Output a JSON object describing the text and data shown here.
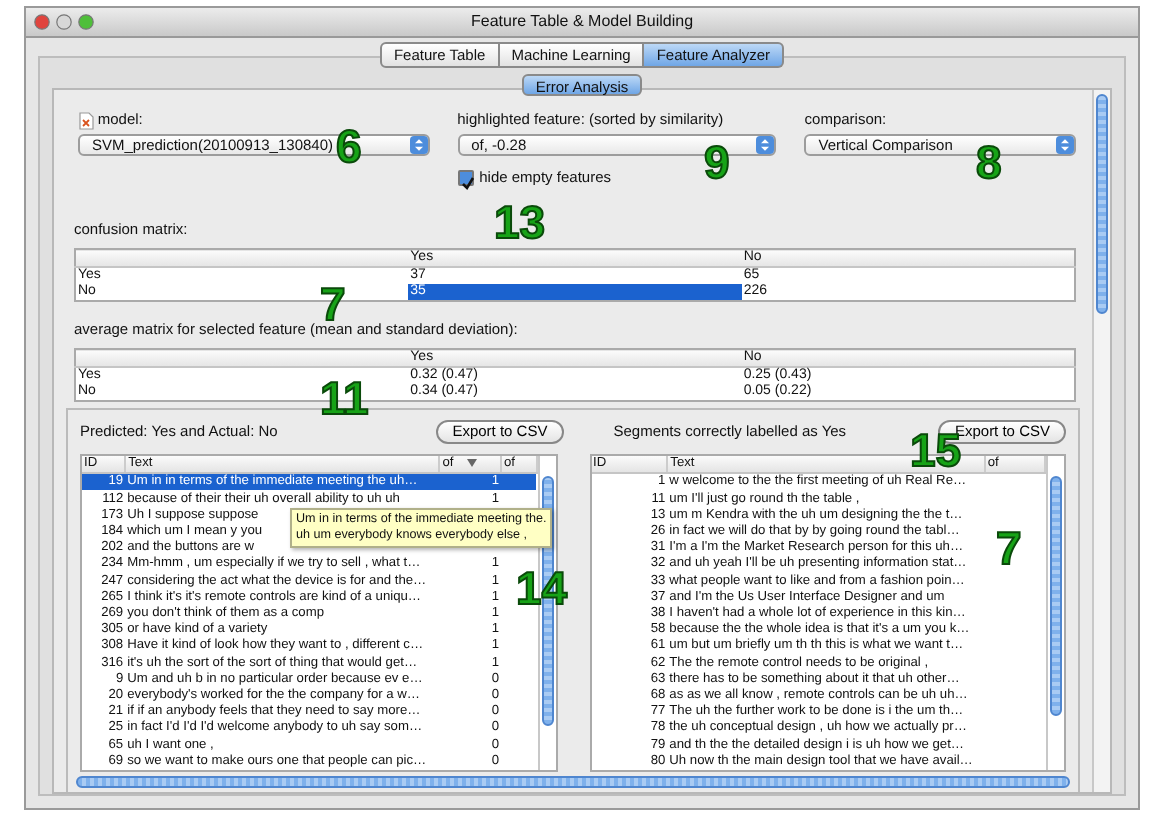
{
  "window": {
    "title": "Feature Table & Model Building"
  },
  "tabs": [
    {
      "label": "Feature Table",
      "selected": false
    },
    {
      "label": "Machine Learning",
      "selected": false
    },
    {
      "label": "Feature Analyzer",
      "selected": true
    }
  ],
  "subtabs": [
    {
      "label": "Error Analysis",
      "selected": true
    }
  ],
  "model": {
    "label": "model:",
    "value": "SVM_prediction(20100913_130840)"
  },
  "highlighted_feature": {
    "label": "highlighted feature: (sorted by similarity)",
    "value": "of, -0.28"
  },
  "comparison": {
    "label": "comparison:",
    "value": "Vertical Comparison"
  },
  "hide_empty": {
    "label": "hide empty features",
    "checked": true
  },
  "confusion_matrix": {
    "label": "confusion matrix:",
    "columns": [
      "Yes",
      "No"
    ],
    "rows": [
      {
        "label": "Yes",
        "cells": [
          {
            "text": "37",
            "selected": false
          },
          {
            "text": "65",
            "selected": false
          }
        ]
      },
      {
        "label": "No",
        "cells": [
          {
            "text": "35",
            "selected": true
          },
          {
            "text": "226",
            "selected": false
          }
        ]
      }
    ]
  },
  "average_matrix": {
    "label": "average matrix for selected feature (mean and standard deviation):",
    "columns": [
      "Yes",
      "No"
    ],
    "rows": [
      {
        "label": "Yes",
        "cells": [
          {
            "text": "0.32 (0.47)",
            "selected": false
          },
          {
            "text": "0.25 (0.43)",
            "selected": false
          }
        ]
      },
      {
        "label": "No",
        "cells": [
          {
            "text": "0.34 (0.47)",
            "selected": false
          },
          {
            "text": "0.05 (0.22)",
            "selected": false
          }
        ]
      }
    ]
  },
  "left_panel": {
    "title": "Predicted: Yes and Actual: No",
    "export_button": "Export to CSV",
    "columns": [
      {
        "label": "ID",
        "sorted": false
      },
      {
        "label": "Text",
        "sorted": false
      },
      {
        "label": "of",
        "sorted": true
      },
      {
        "label": "of",
        "sorted": false
      }
    ],
    "rows": [
      {
        "id": "19",
        "text": "Um in in terms of the immediate meeting the uh…",
        "value": "1",
        "selected": true
      },
      {
        "id": "112",
        "text": "because of their their uh overall ability to uh uh",
        "value": "1",
        "selected": false
      },
      {
        "id": "173",
        "text": "Uh I suppose suppose",
        "selected": false
      },
      {
        "id": "184",
        "text": "which um I mean y you",
        "selected": false
      },
      {
        "id": "202",
        "text": "and the buttons are w",
        "selected": false
      },
      {
        "id": "234",
        "text": "Mm-hmm , um especially if we try to sell , what t…",
        "value": "1",
        "selected": false
      },
      {
        "id": "247",
        "text": "considering the act what the device is for and the…",
        "value": "1",
        "selected": false
      },
      {
        "id": "265",
        "text": "I think it's it's remote controls are kind of a uniqu…",
        "value": "1",
        "selected": false
      },
      {
        "id": "269",
        "text": "you don't think of them as a comp",
        "value": "1",
        "selected": false
      },
      {
        "id": "305",
        "text": "or have kind of a variety",
        "value": "1",
        "selected": false
      },
      {
        "id": "308",
        "text": "Have it kind of look how they want to , different c…",
        "value": "1",
        "selected": false
      },
      {
        "id": "316",
        "text": "it's uh the sort of the sort of thing that would get…",
        "value": "1",
        "selected": false
      },
      {
        "id": "9",
        "text": "Um and uh b in no particular order because ev e…",
        "value": "0",
        "selected": false
      },
      {
        "id": "20",
        "text": "everybody's worked for the the company for a w…",
        "value": "0",
        "selected": false
      },
      {
        "id": "21",
        "text": "if if an anybody feels that they need to say more…",
        "value": "0",
        "selected": false
      },
      {
        "id": "25",
        "text": "in fact I'd I'd I'd welcome anybody to uh say som…",
        "value": "0",
        "selected": false
      },
      {
        "id": "65",
        "text": "uh I want one ,",
        "value": "0",
        "selected": false
      },
      {
        "id": "69",
        "text": "so we want to make ours one that people can pic…",
        "value": "0",
        "selected": false
      }
    ],
    "tooltip": [
      "Um in in terms of the immediate meeting the.",
      "uh um everybody knows everybody else ,"
    ]
  },
  "right_panel": {
    "title": "Segments correctly labelled as Yes",
    "export_button": "Export to CSV",
    "columns": [
      {
        "label": "ID",
        "sorted": false
      },
      {
        "label": "Text",
        "sorted": false
      },
      {
        "label": "of",
        "sorted": false
      }
    ],
    "rows": [
      {
        "id": "1",
        "text": "w welcome to the the first meeting of uh Real Re…",
        "selected": false
      },
      {
        "id": "11",
        "text": "um I'll just go round th the table ,",
        "selected": false
      },
      {
        "id": "13",
        "text": "um m Kendra with the uh um designing the the t…",
        "selected": false
      },
      {
        "id": "26",
        "text": "in fact we will do that by by going round the tabl…",
        "selected": false
      },
      {
        "id": "31",
        "text": "I'm a I'm the Market Research person for this uh…",
        "selected": false
      },
      {
        "id": "32",
        "text": "and uh yeah I'll be uh presenting information stat…",
        "selected": false
      },
      {
        "id": "33",
        "text": "what people want to like and from a fashion poin…",
        "selected": false
      },
      {
        "id": "37",
        "text": "and I'm the Us User Interface Designer and um",
        "selected": false
      },
      {
        "id": "38",
        "text": "I haven't had a whole lot of experience in this kin…",
        "selected": false
      },
      {
        "id": "58",
        "text": "because the the whole idea is that it's a um you k…",
        "selected": false
      },
      {
        "id": "61",
        "text": "um but um briefly um th th this is what we want t…",
        "selected": false
      },
      {
        "id": "62",
        "text": "The the remote control needs to be original ,",
        "selected": false
      },
      {
        "id": "63",
        "text": "there has to be something about it that uh other…",
        "selected": false
      },
      {
        "id": "68",
        "text": "as as we all know , remote controls can be uh uh…",
        "selected": false
      },
      {
        "id": "77",
        "text": "The uh the further work to be done is i the um th…",
        "selected": false
      },
      {
        "id": "78",
        "text": "the uh conceptual design , uh how we actually pr…",
        "selected": false
      },
      {
        "id": "79",
        "text": "and th the the detailed design i is uh how we get…",
        "selected": false
      },
      {
        "id": "80",
        "text": "Uh now th the main design tool that we have avail…",
        "selected": false
      }
    ]
  },
  "annotations": [
    {
      "text": "6"
    },
    {
      "text": "9"
    },
    {
      "text": "8"
    },
    {
      "text": "13"
    },
    {
      "text": "7"
    },
    {
      "text": "11"
    },
    {
      "text": "15"
    },
    {
      "text": "14"
    },
    {
      "text": "7"
    }
  ]
}
